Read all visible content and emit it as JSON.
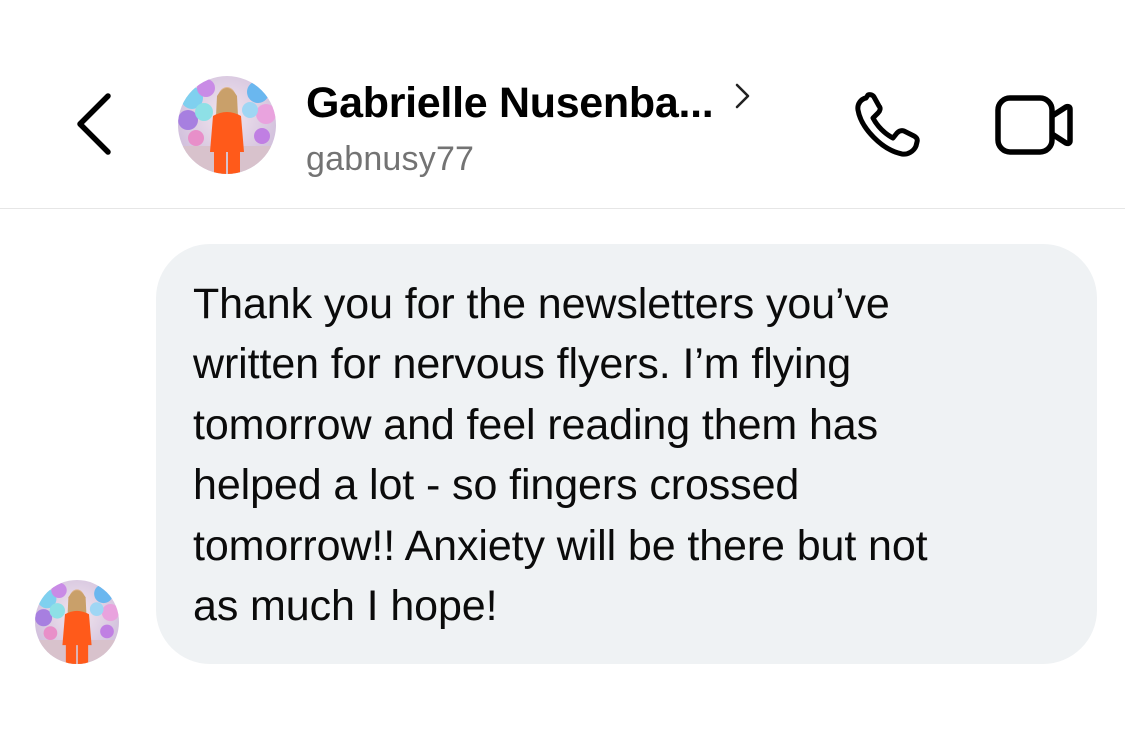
{
  "header": {
    "contact_name": "Gabrielle Nusenba...",
    "username": "gabnusy77",
    "back_icon": "chevron-left-icon",
    "profile_chevron_icon": "chevron-right-icon",
    "call_icon": "phone-icon",
    "video_icon": "video-camera-icon"
  },
  "conversation": {
    "messages": [
      {
        "sender": "gabnusy77",
        "text": "Thank you for the newsletters you’ve\nwritten for nervous flyers. I’m flying\ntomorrow and feel reading them has\nhelped a lot - so fingers crossed\ntomorrow!! Anxiety will be there but not\nas much I hope!"
      }
    ]
  },
  "colors": {
    "bubble_background": "#eff2f4",
    "secondary_text": "#737373",
    "divider": "#e6e6e6"
  }
}
